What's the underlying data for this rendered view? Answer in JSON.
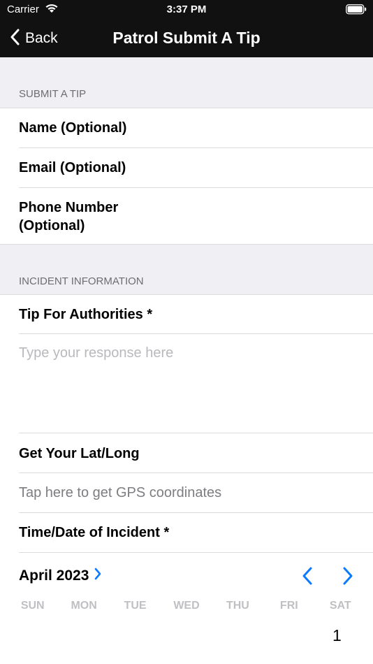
{
  "status_bar": {
    "carrier": "Carrier",
    "time": "3:37 PM"
  },
  "nav": {
    "back_label": "Back",
    "title": "Patrol Submit A Tip"
  },
  "sections": {
    "submit_tip_header": "SUBMIT A TIP",
    "incident_header": "INCIDENT INFORMATION"
  },
  "fields": {
    "name_label": "Name (Optional)",
    "email_label": "Email (Optional)",
    "phone_label_line1": "Phone Number",
    "phone_label_line2": "(Optional)",
    "tip_label": "Tip For Authorities *",
    "tip_placeholder": "Type your response here",
    "latlong_label": "Get Your Lat/Long",
    "gps_link": "Tap here to get GPS coordinates",
    "datetime_label": "Time/Date of Incident *"
  },
  "calendar": {
    "month_label": "April 2023",
    "weekdays": [
      "SUN",
      "MON",
      "TUE",
      "WED",
      "THU",
      "FRI",
      "SAT"
    ],
    "visible_day": "1"
  },
  "colors": {
    "accent": "#0a7aff",
    "nav_bg": "#111111",
    "section_bg": "#efeff4"
  }
}
